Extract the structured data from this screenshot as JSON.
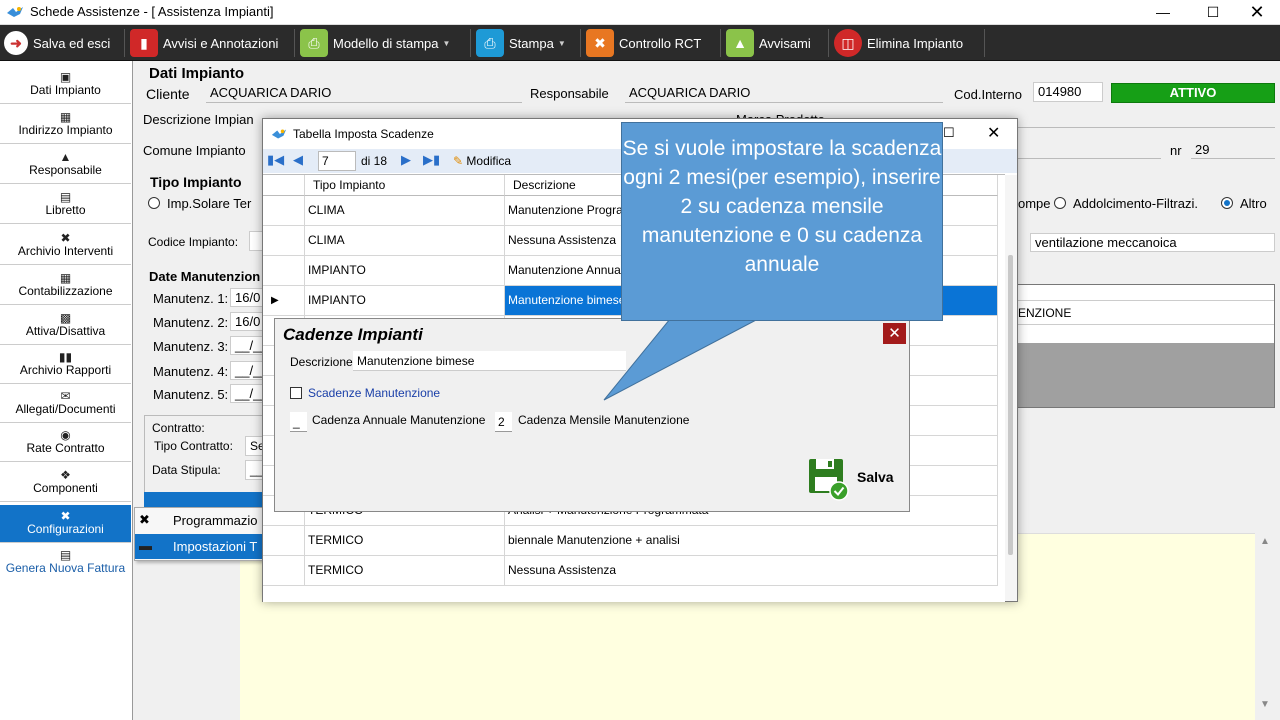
{
  "window": {
    "title": "Schede Assistenze - [ Assistenza Impianti]"
  },
  "toolbar": {
    "save_exit": "Salva ed esci",
    "avvisi": "Avvisi e Annotazioni",
    "modello": "Modello di stampa",
    "stampa": "Stampa",
    "controllo": "Controllo RCT",
    "avvisami": "Avvisami",
    "elimina": "Elimina Impianto"
  },
  "nav": {
    "items": [
      {
        "label": "Dati Impianto",
        "icon": "factory-icon"
      },
      {
        "label": "Indirizzo Impianto",
        "icon": "building-icon"
      },
      {
        "label": "Responsabile",
        "icon": "user-icon"
      },
      {
        "label": "Libretto",
        "icon": "book-icon"
      },
      {
        "label": "Archivio Interventi",
        "icon": "tools-icon"
      },
      {
        "label": "Contabilizzazione",
        "icon": "calculator-icon"
      },
      {
        "label": "Attiva/Disattiva",
        "icon": "toggle-icon"
      },
      {
        "label": "Archivio Rapporti",
        "icon": "archive-icon"
      },
      {
        "label": "Allegati/Documenti",
        "icon": "attachment-icon"
      },
      {
        "label": "Rate Contratto",
        "icon": "coins-icon"
      },
      {
        "label": "Componenti",
        "icon": "components-icon"
      },
      {
        "label": "Configurazioni",
        "icon": "wrench-icon"
      },
      {
        "label": "Genera Nuova Fattura",
        "icon": "invoice-icon"
      }
    ],
    "flyout": [
      "Programmazio",
      "Impostazioni T"
    ]
  },
  "main": {
    "section_title": "Dati Impianto",
    "cliente_label": "Cliente",
    "cliente": "ACQUARICA DARIO",
    "responsabile_label": "Responsabile",
    "responsabile": "ACQUARICA DARIO",
    "cod_label": "Cod.Interno",
    "cod": "014980",
    "status": "ATTIVO",
    "descrizione_label": "Descrizione Impian",
    "marca_label": "Marca Prodotto",
    "comune_label": "Comune Impianto",
    "nr_label": "nr",
    "nr": "29",
    "tipo_title": "Tipo Impianto",
    "radio_solare": "Imp.Solare Ter",
    "radio_pompe": "ompe",
    "radio_addolc": "Addolcimento-Filtrazi.",
    "radio_altro": "Altro",
    "codice_label": "Codice Impianto:",
    "ventilazione": "ventilazione meccanoica",
    "date_title": "Date Manutenzion",
    "manut": [
      {
        "label": "Manutenz. 1:",
        "value": "16/0"
      },
      {
        "label": "Manutenz. 2:",
        "value": "16/0"
      },
      {
        "label": "Manutenz. 3:",
        "value": "__/__"
      },
      {
        "label": "Manutenz. 4:",
        "value": "__/__"
      },
      {
        "label": "Manutenz. 5:",
        "value": "__/__"
      }
    ],
    "contratto_label": "Contratto:",
    "tipo_contratto_label": "Tipo Contratto:",
    "tipo_contratto": "Se",
    "data_stipula_label": "Data Stipula:",
    "data_stipula": "__",
    "right_panel_text": "ENZIONE"
  },
  "dialog": {
    "title": "Tabella Imposta Scadenze",
    "record": "7",
    "of": "di 18",
    "modifica": "Modifica",
    "headers": [
      "Tipo Impianto",
      "Descrizione"
    ],
    "rows": [
      [
        "CLIMA",
        "Manutenzione Programm"
      ],
      [
        "CLIMA",
        "Nessuna Assistenza"
      ],
      [
        "IMPIANTO",
        "Manutenzione Annuale"
      ],
      [
        "IMPIANTO",
        "Manutenzione bimese"
      ],
      [
        "",
        "Analisi + Manutenzione"
      ],
      [
        "TERMICO",
        "Analisi + Manutenzione Programmata"
      ],
      [
        "TERMICO",
        "biennale Manutenzione + analisi"
      ],
      [
        "TERMICO",
        "Nessuna Assistenza"
      ]
    ]
  },
  "cadenze": {
    "title": "Cadenze Impianti",
    "descr_label": "Descrizione",
    "descr": "Manutenzione bimese",
    "scadenze_label": "Scadenze Manutenzione",
    "annuale_value": "_",
    "annuale_label": "Cadenza Annuale Manutenzione",
    "mensile_value": "2",
    "mensile_label": "Cadenza Mensile Manutenzione",
    "save": "Salva"
  },
  "callout": {
    "text": "Se si vuole impostare la scadenza ogni 2 mesi(per esempio), inserire 2 su cadenza mensile manutenzione e 0 su cadenza annuale"
  },
  "colors": {
    "accent": "#1273c8",
    "status_green": "#169f16",
    "callout": "#5b9bd5",
    "toolbar": "#2b2b2b"
  }
}
